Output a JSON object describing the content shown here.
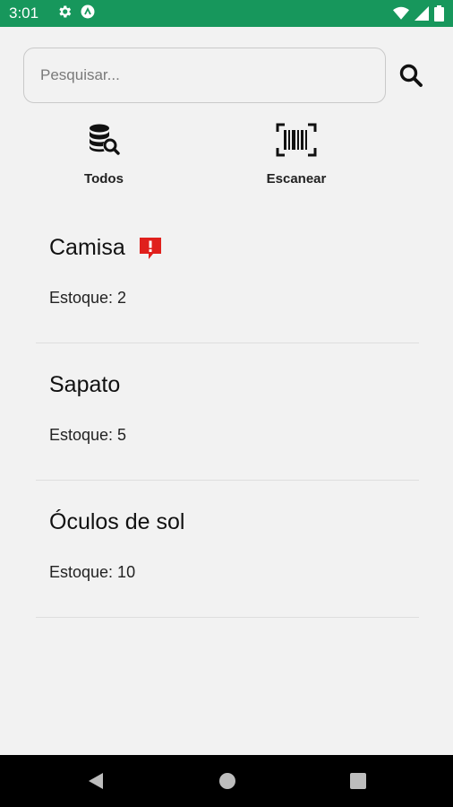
{
  "status_bar": {
    "time": "3:01",
    "icons": [
      "settings-icon",
      "app-badge-icon",
      "wifi-icon",
      "signal-icon",
      "battery-icon"
    ],
    "color": "#17975c"
  },
  "search": {
    "placeholder": "Pesquisar...",
    "value": "",
    "button_icon": "search-icon"
  },
  "actions": [
    {
      "label": "Todos",
      "icon": "database-search-icon"
    },
    {
      "label": "Escanear",
      "icon": "barcode-scan-icon"
    }
  ],
  "products": [
    {
      "name": "Camisa",
      "stock_text": "Estoque: 2",
      "alert": true
    },
    {
      "name": "Sapato",
      "stock_text": "Estoque: 5",
      "alert": false
    },
    {
      "name": "Óculos de sol",
      "stock_text": "Estoque: 10",
      "alert": false
    }
  ],
  "colors": {
    "accent": "#17975c",
    "alert": "#e0201c",
    "background": "#f2f2f2"
  },
  "nav_bar": {
    "buttons": [
      "back-icon",
      "home-icon",
      "recents-icon"
    ]
  }
}
